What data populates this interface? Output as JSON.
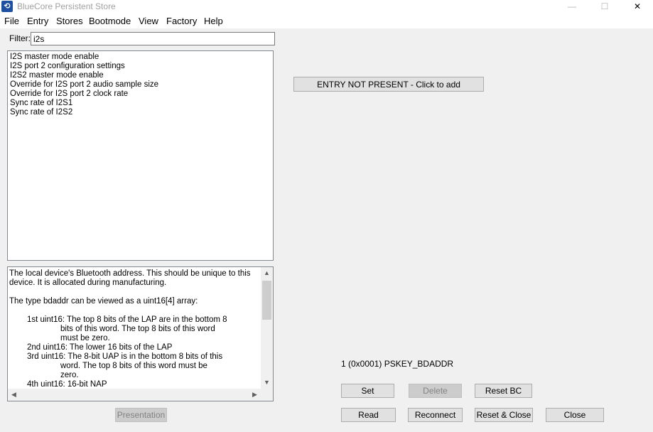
{
  "window": {
    "title": "BlueCore Persistent Store",
    "minimize_glyph": "—",
    "maximize_glyph": "☐",
    "close_glyph": "✕"
  },
  "menu": [
    "File",
    "Entry",
    "Stores",
    "Bootmode",
    "View",
    "Factory",
    "Help"
  ],
  "filter": {
    "label": "Filter:",
    "value": "i2s"
  },
  "keys_list": [
    "I2S master mode enable",
    "I2S port 2 configuration settings",
    "I2S2 master mode enable",
    "Override for I2S port 2 audio sample size",
    "Override for I2S port 2 clock rate",
    "Sync rate of I2S1",
    "Sync rate of I2S2"
  ],
  "description": {
    "lines": [
      "The local device's Bluetooth address.  This should be unique to this",
      "device. It is allocated during manufacturing.",
      "",
      "The type bdaddr can be viewed as a uint16[4] array:",
      "",
      "1st uint16:     The top 8 bits of the LAP are in the bottom 8",
      "bits of this word. The top 8 bits of this word",
      "must be zero.",
      "2nd uint16:     The lower 16 bits of the LAP",
      "3rd uint16:     The 8-bit UAP is in the bottom 8 bits of this",
      "word. The top 8 bits of this word must be",
      "zero.",
      "4th uint16:     16-bit NAP"
    ]
  },
  "entry_button": "ENTRY NOT PRESENT - Click to add",
  "pskey_label": "1 (0x0001) PSKEY_BDADDR",
  "buttons": {
    "presentation": "Presentation",
    "set": "Set",
    "delete": "Delete",
    "reset_bc": "Reset BC",
    "read": "Read",
    "reconnect": "Reconnect",
    "reset_close": "Reset & Close",
    "close": "Close"
  }
}
